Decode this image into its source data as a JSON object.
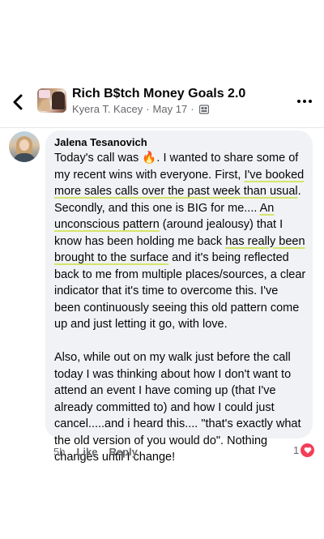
{
  "header": {
    "group_name": "Rich B$tch Money Goals 2.0",
    "poster_name": "Kyera T. Kacey",
    "separator": "·",
    "post_date": "May 17",
    "privacy_icon": "group-members-icon"
  },
  "comment": {
    "author": "Jalena Tesanovich",
    "lines": [
      [
        {
          "t": "Today's call was "
        },
        {
          "t": "🔥",
          "emoji": true
        },
        {
          "t": ". I wanted to share some of"
        }
      ],
      [
        {
          "t": "my recent wins with everyone. First, "
        },
        {
          "t": "I've booked",
          "hl": true
        }
      ],
      [
        {
          "t": "more sales calls over the past week than usual",
          "hl": true
        },
        {
          "t": "."
        }
      ],
      [
        {
          "t": "Secondly, and this one is BIG for me.... "
        },
        {
          "t": "An",
          "hl": true
        }
      ],
      [
        {
          "t": "unconscious pattern",
          "hl": true
        },
        {
          "t": " (around jealousy) that I"
        }
      ],
      [
        {
          "t": "know has been holding me back "
        },
        {
          "t": "has really been",
          "hl": true
        }
      ],
      [
        {
          "t": "brought to the surface",
          "hl": true
        },
        {
          "t": " and it's being reflected"
        }
      ],
      [
        {
          "t": "back to me from multiple places/sources, a clear"
        }
      ],
      [
        {
          "t": "indicator that it's time to overcome this. I've"
        }
      ],
      [
        {
          "t": "been continuously seeing this old pattern come"
        }
      ],
      [
        {
          "t": "up and just letting it go, with love."
        }
      ],
      [],
      [
        {
          "t": "Also, while out on my walk just before the call"
        }
      ],
      [
        {
          "t": "today I was thinking about how I don't want to"
        }
      ],
      [
        {
          "t": "attend an event I have coming up (that I've"
        }
      ],
      [
        {
          "t": "already committed to) and how I could just"
        }
      ],
      [
        {
          "t": "cancel.....and i heard this.... \"that's exactly what"
        }
      ],
      [
        {
          "t": "the old version of you would do\".  Nothing"
        }
      ],
      [
        {
          "t": "changes until I change!"
        }
      ]
    ],
    "time": "5h",
    "like_label": "Like",
    "reply_label": "Reply",
    "reaction_count": "1",
    "reaction_icon": "love-reaction-icon"
  },
  "colors": {
    "bubble_bg": "#f0f2f5",
    "highlight_underline": "#d6e46c",
    "secondary_text": "#65676b",
    "heart": "#f33e58"
  }
}
